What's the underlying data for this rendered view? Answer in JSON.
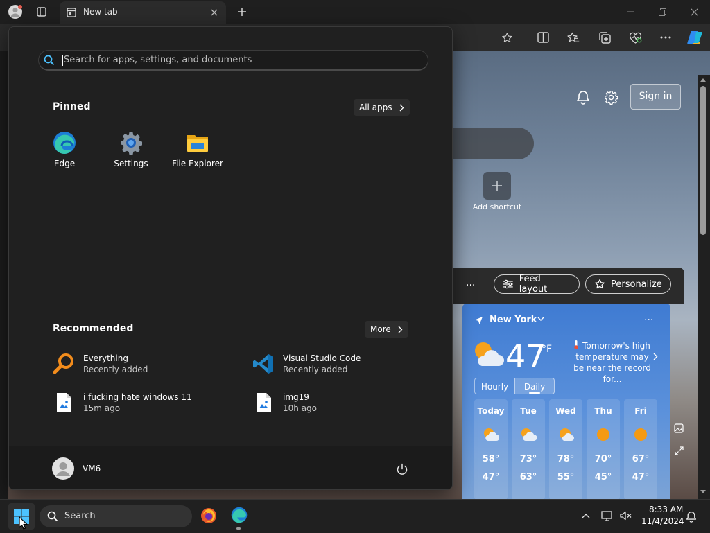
{
  "browser": {
    "tab_title": "New tab",
    "new_tab_page": {
      "sign_in_label": "Sign in",
      "add_shortcut_label": "Add shortcut",
      "feed_layout_label": "Feed layout",
      "personalize_label": "Personalize",
      "more_label": "..."
    }
  },
  "weather": {
    "location": "New York",
    "temperature": "47",
    "unit": "°F",
    "alert": "Tomorrow's high temperature may be near the record for...",
    "tabs": [
      "Hourly",
      "Daily"
    ],
    "more_label": "...",
    "forecast": [
      {
        "day": "Today",
        "high": "58°",
        "low": "47°",
        "icon": "partly-cloudy-icon"
      },
      {
        "day": "Tue",
        "high": "73°",
        "low": "63°",
        "icon": "partly-cloudy-icon"
      },
      {
        "day": "Wed",
        "high": "78°",
        "low": "55°",
        "icon": "partly-cloudy-icon"
      },
      {
        "day": "Thu",
        "high": "70°",
        "low": "45°",
        "icon": "sunny-icon"
      },
      {
        "day": "Fri",
        "high": "67°",
        "low": "47°",
        "icon": "sunny-icon"
      }
    ]
  },
  "start_menu": {
    "search_placeholder": "Search for apps, settings, and documents",
    "pinned_title": "Pinned",
    "all_apps_label": "All apps",
    "pinned": [
      {
        "label": "Edge",
        "icon": "edge-icon"
      },
      {
        "label": "Settings",
        "icon": "settings-gear-icon"
      },
      {
        "label": "File Explorer",
        "icon": "folder-icon"
      }
    ],
    "recommended_title": "Recommended",
    "more_label": "More",
    "recommended": [
      {
        "name": "Everything",
        "sub": "Recently added",
        "icon": "everything-search-icon"
      },
      {
        "name": "Visual Studio Code",
        "sub": "Recently added",
        "icon": "vscode-icon"
      },
      {
        "name": "i fucking hate windows 11",
        "sub": "15m ago",
        "icon": "image-file-icon"
      },
      {
        "name": "img19",
        "sub": "10h ago",
        "icon": "image-file-icon"
      }
    ],
    "user_name": "VM6"
  },
  "taskbar": {
    "search_label": "Search",
    "time": "8:33 AM",
    "date": "11/4/2024"
  },
  "colors": {
    "accent": "#4cc2ff",
    "weather_card": "#3f7bd2",
    "start_bg": "#202020"
  }
}
